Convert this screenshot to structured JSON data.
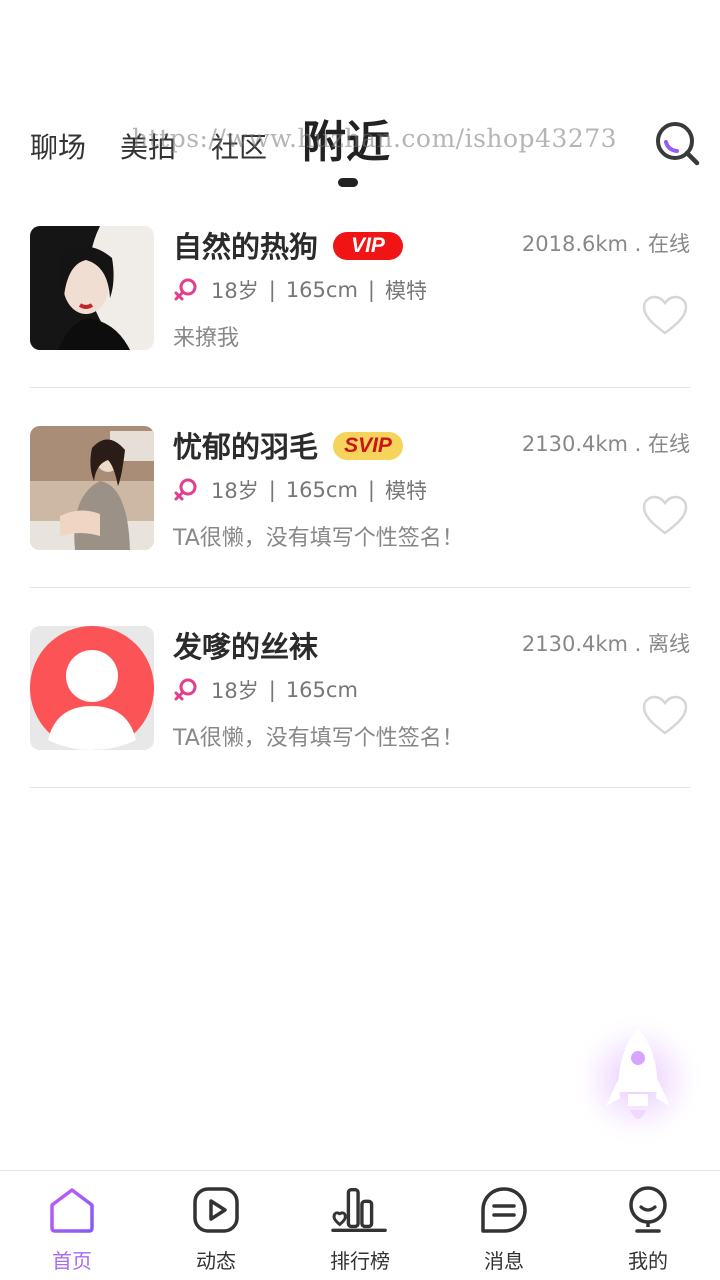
{
  "tabs": [
    {
      "label": "聊场",
      "active": false
    },
    {
      "label": "美拍",
      "active": false
    },
    {
      "label": "社区",
      "active": false
    },
    {
      "label": "附近",
      "active": true
    }
  ],
  "watermark": "https://www.huzhan.com/ishop43273",
  "search_icon": "search-icon",
  "users": [
    {
      "name": "自然的热狗",
      "badge": "VIP",
      "distance_status": "2018.6km . 在线",
      "age": "18岁",
      "height": "165cm",
      "occupation": "模特",
      "signature": "来撩我",
      "avatar": "photo-dark-hair-girl"
    },
    {
      "name": "忧郁的羽毛",
      "badge": "SVIP",
      "distance_status": "2130.4km . 在线",
      "age": "18岁",
      "height": "165cm",
      "occupation": "模特",
      "signature": "TA很懒，没有填写个性签名！",
      "avatar": "photo-girl-sitting"
    },
    {
      "name": "发嗲的丝袜",
      "badge": "",
      "distance_status": "2130.4km . 离线",
      "age": "18岁",
      "height": "165cm",
      "occupation": "",
      "signature": "TA很懒，没有填写个性签名！",
      "avatar": "default-avatar"
    }
  ],
  "colors": {
    "accent": "#a66cf5",
    "gender": "#e23d8f",
    "vip_bg": "#f01414",
    "svip_bg": "#f6d35a"
  },
  "bottom_nav": [
    {
      "label": "首页",
      "icon": "home-icon",
      "active": true
    },
    {
      "label": "动态",
      "icon": "play-icon",
      "active": false
    },
    {
      "label": "排行榜",
      "icon": "ranking-icon",
      "active": false
    },
    {
      "label": "消息",
      "icon": "message-icon",
      "active": false
    },
    {
      "label": "我的",
      "icon": "profile-icon",
      "active": false
    }
  ]
}
